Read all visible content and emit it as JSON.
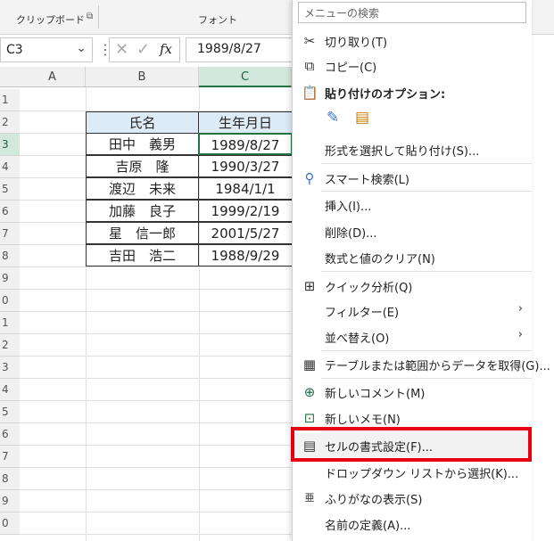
{
  "ribbon": {
    "clipboard_label": "クリップボード",
    "font_label": "フォント"
  },
  "formula_bar": {
    "cell_ref": "C3",
    "fx_symbol": "fx",
    "value": "1989/8/27"
  },
  "columns": [
    "A",
    "B",
    "C"
  ],
  "rows": [
    "1",
    "2",
    "3",
    "4",
    "5",
    "6",
    "7",
    "8",
    "9",
    "0",
    "1",
    "2",
    "3",
    "4",
    "5",
    "6",
    "7",
    "8",
    "9",
    "0"
  ],
  "table": {
    "headers": [
      "氏名",
      "生年月日"
    ],
    "rows": [
      [
        "田中　義男",
        "1989/8/27"
      ],
      [
        "吉原　隆",
        "1990/3/27"
      ],
      [
        "渡辺　未来",
        "1984/1/1"
      ],
      [
        "加藤　良子",
        "1999/2/19"
      ],
      [
        "星　信一郎",
        "2001/5/27"
      ],
      [
        "吉田　浩二",
        "1988/9/29"
      ]
    ]
  },
  "menu": {
    "search_placeholder": "メニューの検索",
    "items": [
      {
        "label": "切り取り(T)"
      },
      {
        "label": "コピー(C)"
      },
      {
        "label": "貼り付けのオプション:"
      },
      {
        "label": "形式を選択して貼り付け(S)..."
      },
      {
        "label": "スマート検索(L)"
      },
      {
        "label": "挿入(I)..."
      },
      {
        "label": "削除(D)..."
      },
      {
        "label": "数式と値のクリア(N)"
      },
      {
        "label": "クイック分析(Q)"
      },
      {
        "label": "フィルター(E)"
      },
      {
        "label": "並べ替え(O)"
      },
      {
        "label": "テーブルまたは範囲からデータを取得(G)..."
      },
      {
        "label": "新しいコメント(M)"
      },
      {
        "label": "新しいメモ(N)"
      },
      {
        "label": "セルの書式設定(F)..."
      },
      {
        "label": "ドロップダウン リストから選択(K)..."
      },
      {
        "label": "ふりがなの表示(S)"
      },
      {
        "label": "名前の定義(A)..."
      }
    ]
  },
  "colors": {
    "highlight": "#e60012",
    "header_fill": "#ddebf7",
    "selected_accent": "#217346"
  }
}
